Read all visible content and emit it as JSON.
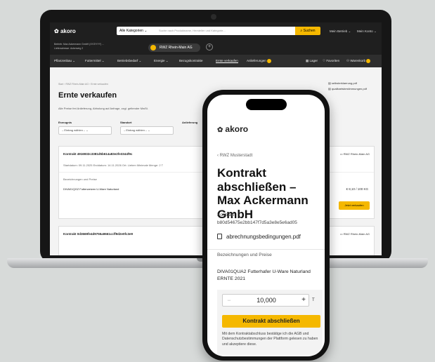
{
  "desktop": {
    "logo": "akoro",
    "category_select": "Alle Kategorien",
    "search_placeholder": "Suche nach Produktname, Hersteller und Kategorie...",
    "search_button": "Suchen",
    "top_links": [
      "Mein Betrieb",
      "Mein Konto"
    ],
    "sub_header": {
      "line1": "Betrieb: Max Ackermann GmbH (XYZ/YYY) ...",
      "line2": "Lieferadresse: Ackerweg 2"
    },
    "company_tab": "RWZ Rhein-Main AG",
    "add_tab": "+",
    "nav_items": [
      "Pflanzenbau",
      "Futtermittel",
      "Betriebsbedarf",
      "Energie",
      "Bezugskontrakte",
      "Ernte verkaufen",
      "Anlieferungen"
    ],
    "nav_active": "Ernte verkaufen",
    "nav_right": [
      "Lager",
      "Favoriten",
      "Warenkorb"
    ],
    "breadcrumb": "Start › RWZ Rhein-Main AG › Ernte verkaufen",
    "page_title": "Ernte verkaufen",
    "price_note": "Alle Preise frei Anlieferung, Abholung auf Anfrage, zzgl. geltender MwSt.",
    "doc_links": [
      "selbsterklaerung.pdf",
      "qualitaetsbestimmungen.pdf"
    ],
    "filters": [
      {
        "label": "Erzeugnis",
        "value": "– Eintrag wählen –"
      },
      {
        "label": "Standort",
        "value": "– Eintrag wählen –"
      },
      {
        "label": "Anlieferung",
        "value": ""
      }
    ],
    "cards": [
      {
        "title": "Kontrakt 4916932c3381d5b614a83e2fe3344f9c",
        "meta": "Startdatum: 09.11.2025   Enddatum: 14.11.2026   Ort: Lieben   Minimale Menge: 2 T",
        "section": "Bezeichnungen und Preise",
        "product": "DIVA01QGZ Futterweizen U-Ware Naturland",
        "seller": "RWZ Rhein-Main AG",
        "price": "€ 8,10 / 100 KG",
        "button": "Jetzt verkaufen"
      },
      {
        "title": "Kontrakt 0d3669fe4d9755a9661ccff9d2e0fc3e9",
        "seller": "RWZ Rhein-Main AG"
      }
    ]
  },
  "phone": {
    "logo": "akoro",
    "back_link": "‹ RWZ Musterstadt",
    "title": "Kontrakt abschließen – Max Ackermann GmbH",
    "kontrakt_label": "Kontrakt",
    "kontrakt_id": "b80d54675e2bb147f7d5a3e8e5e6ad05",
    "doc": "abrechnungsbedingungen.pdf",
    "section_label": "Bezeichnungen und Preise",
    "product": "DIVA01QUA2 Futterhafer U-Ware Naturland ERNTE 2021",
    "qty_minus": "−",
    "qty_value": "10,000",
    "qty_plus": "+",
    "unit": "T",
    "cta": "Kontrakt abschließen",
    "legal": "Mit dem Kontraktabschluss bestätige ich die AGB und Datenschutzbestimmungen der Plattform gelesen zu haben und akzeptiere diese."
  },
  "colors": {
    "accent": "#f5b800",
    "dark": "#1f1f1f",
    "background": "#d7dad9"
  }
}
